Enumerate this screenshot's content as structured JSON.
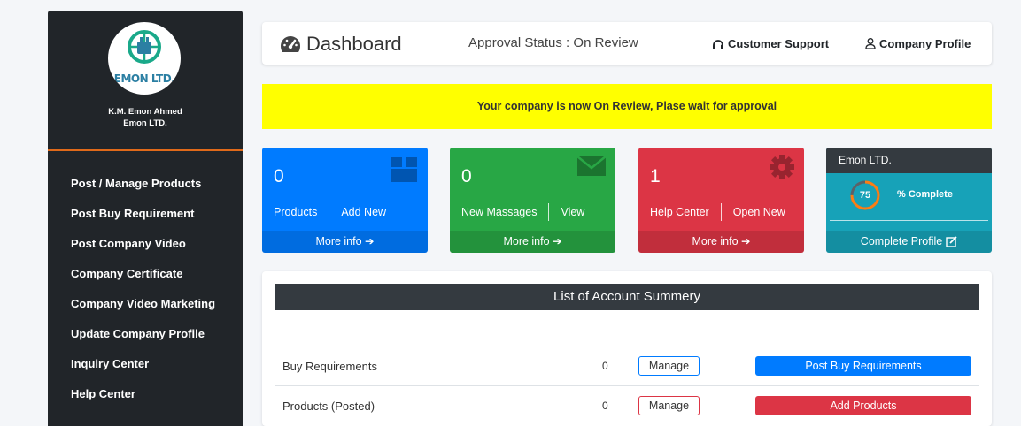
{
  "sidebar": {
    "logo_text": "EMON LTD.",
    "user_name": "K.M. Emon Ahmed",
    "company": "Emon LTD.",
    "items": [
      {
        "label": "Post / Manage Products"
      },
      {
        "label": "Post Buy Requirement"
      },
      {
        "label": "Post Company Video"
      },
      {
        "label": "Company Certificate"
      },
      {
        "label": "Company Video Marketing"
      },
      {
        "label": "Update Company Profile"
      },
      {
        "label": "Inquiry Center"
      },
      {
        "label": "Help Center"
      }
    ]
  },
  "header": {
    "title": "Dashboard",
    "approval_status": "Approval Status : On Review",
    "support_label": "Customer Support",
    "profile_label": "Company Profile"
  },
  "alert": {
    "text": "Your company is now On Review, Plase wait for approval"
  },
  "boxes": {
    "products": {
      "count": "0",
      "link1": "Products",
      "link2": "Add New",
      "more": "More info",
      "color": "#007bff",
      "icon": "box-icon"
    },
    "messages": {
      "count": "0",
      "link1": "New Massages",
      "link2": "View",
      "more": "More info",
      "color": "#28a745",
      "icon": "envelope-icon"
    },
    "help": {
      "count": "1",
      "link1": "Help Center",
      "link2": "Open New",
      "more": "More info",
      "color": "#dc3545",
      "icon": "gear-icon"
    },
    "profile": {
      "title": "Emon LTD.",
      "percent": "75",
      "percent_value": 75,
      "complete_label": "% Complete",
      "action": "Complete Profile",
      "color": "#17a2b8"
    }
  },
  "summary": {
    "title": "List of Account Summery",
    "rows": [
      {
        "label": "Buy Requirements",
        "count": "0",
        "manage": "Manage",
        "action": "Post Buy Requirements",
        "action_color": "#007bff"
      },
      {
        "label": "Products (Posted)",
        "count": "0",
        "manage": "Manage",
        "action": "Add Products",
        "action_color": "#dc3545"
      }
    ]
  }
}
